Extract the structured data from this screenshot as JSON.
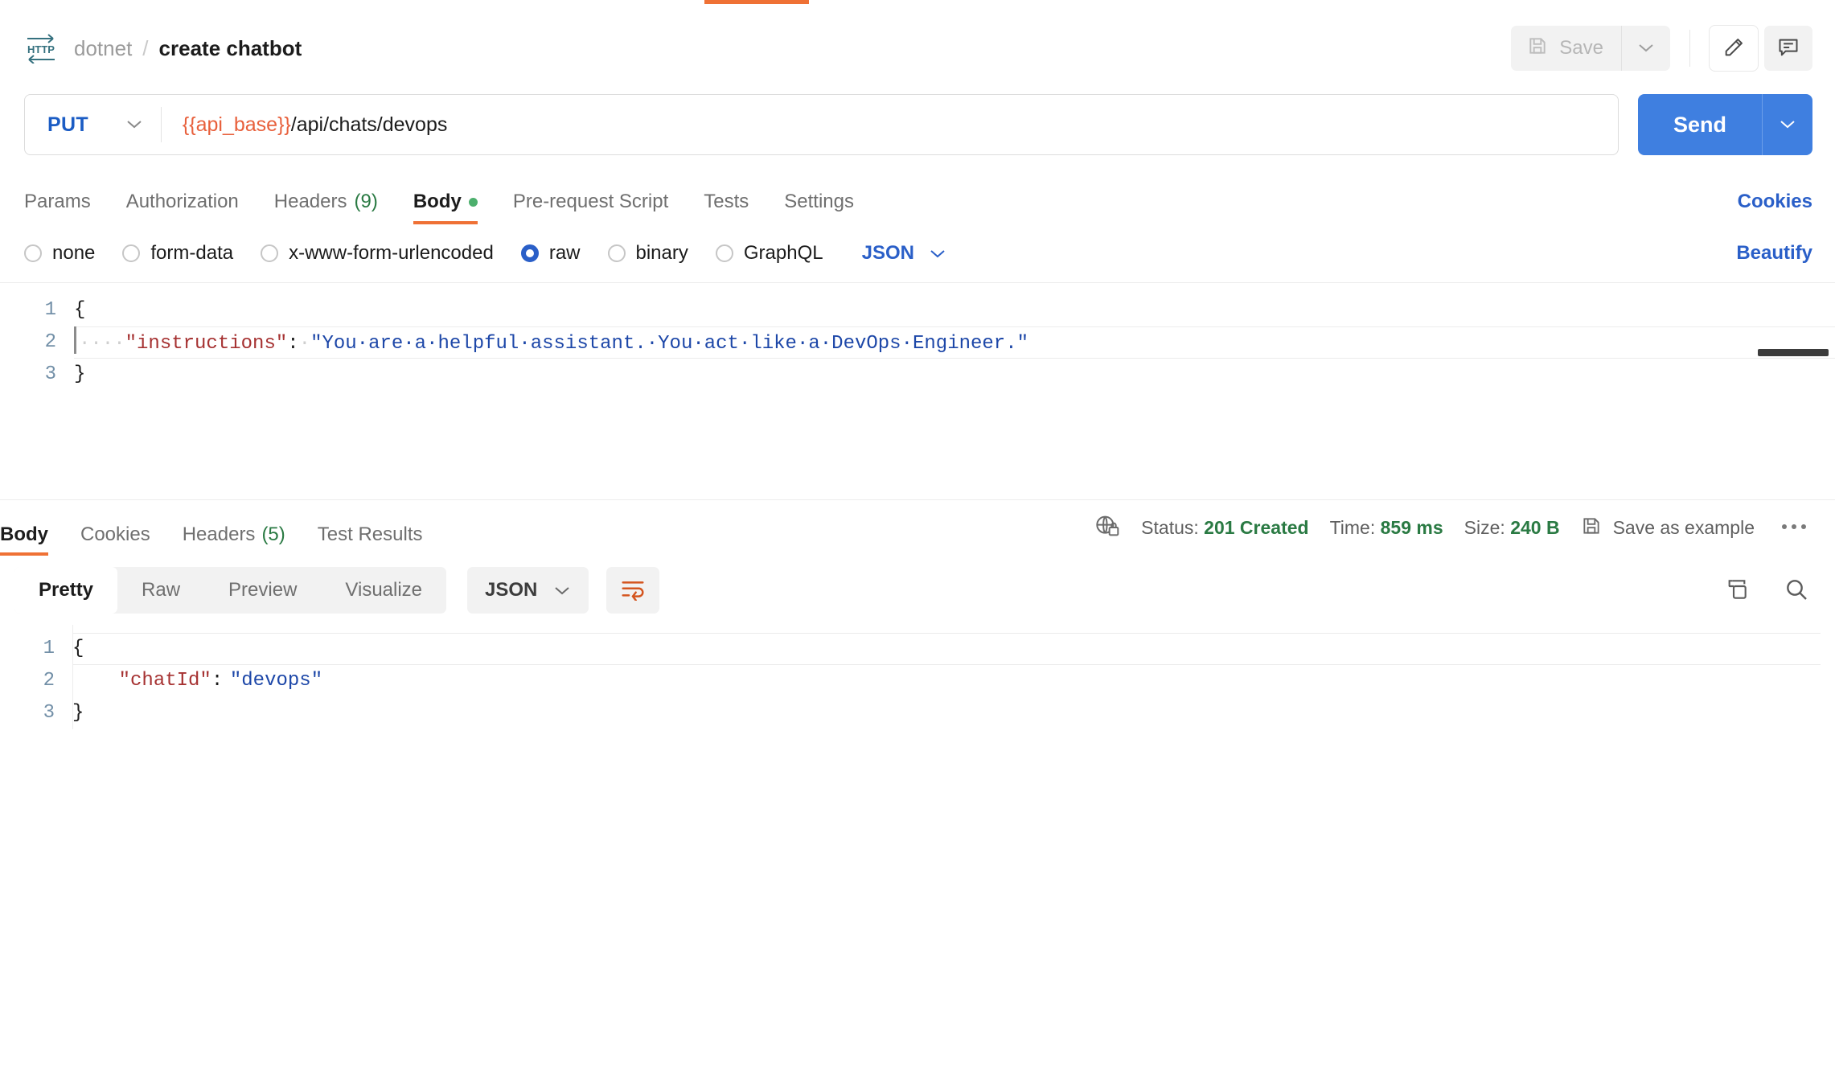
{
  "window": {
    "tab_indicator_color": "#ef7135"
  },
  "header": {
    "protocol_icon": "http-icon",
    "collection": "dotnet",
    "separator": "/",
    "request_name": "create chatbot",
    "save_label": "Save",
    "save_icon": "floppy-disk-icon",
    "save_caret_icon": "chevron-down-icon",
    "edit_icon": "pencil-icon",
    "comment_icon": "comment-icon"
  },
  "urlbar": {
    "method": "PUT",
    "method_color": "#1b5cc4",
    "method_caret_icon": "chevron-down-icon",
    "url_variable": "{{api_base}}",
    "url_path": "/api/chats/devops",
    "url_variable_color": "#e8603c",
    "send_label": "Send",
    "send_caret_icon": "chevron-down-icon",
    "send_color": "#3f7fe0"
  },
  "request_tabs": {
    "items": [
      {
        "label": "Params",
        "count": null,
        "active": false,
        "dot": false
      },
      {
        "label": "Authorization",
        "count": null,
        "active": false,
        "dot": false
      },
      {
        "label": "Headers",
        "count": "(9)",
        "active": false,
        "dot": false
      },
      {
        "label": "Body",
        "count": null,
        "active": true,
        "dot": true
      },
      {
        "label": "Pre-request Script",
        "count": null,
        "active": false,
        "dot": false
      },
      {
        "label": "Tests",
        "count": null,
        "active": false,
        "dot": false
      },
      {
        "label": "Settings",
        "count": null,
        "active": false,
        "dot": false
      }
    ],
    "cookies_link": "Cookies"
  },
  "body_type": {
    "options": [
      {
        "label": "none",
        "selected": false
      },
      {
        "label": "form-data",
        "selected": false
      },
      {
        "label": "x-www-form-urlencoded",
        "selected": false
      },
      {
        "label": "raw",
        "selected": true
      },
      {
        "label": "binary",
        "selected": false
      },
      {
        "label": "GraphQL",
        "selected": false
      }
    ],
    "format": "JSON",
    "format_caret_icon": "chevron-down-icon",
    "beautify_link": "Beautify"
  },
  "request_body": {
    "lines": [
      {
        "num": "1",
        "open_brace": "{"
      },
      {
        "num": "2",
        "indent_dots": "····",
        "key": "\"instructions\"",
        "colon": ":",
        "space_dot": "·",
        "value": "\"You·are·a·helpful·assistant.·You·act·like·a·DevOps·Engineer.\""
      },
      {
        "num": "3",
        "close_brace": "}"
      }
    ],
    "key_color": "#a63232",
    "value_color": "#1d47a8"
  },
  "response_tabs": {
    "items": [
      {
        "label": "Body",
        "count": null,
        "active": true
      },
      {
        "label": "Cookies",
        "count": null,
        "active": false
      },
      {
        "label": "Headers",
        "count": "(5)",
        "active": false
      },
      {
        "label": "Test Results",
        "count": null,
        "active": false
      }
    ]
  },
  "response_meta": {
    "security_icon": "globe-lock-icon",
    "status_label": "Status:",
    "status_value": "201 Created",
    "time_label": "Time:",
    "time_value": "859 ms",
    "size_label": "Size:",
    "size_value": "240 B",
    "save_example_icon": "floppy-disk-icon",
    "save_example_label": "Save as example",
    "more_icon": "ellipsis-icon",
    "value_color": "#2a7a43"
  },
  "response_toolbar": {
    "views": [
      {
        "label": "Pretty",
        "active": true
      },
      {
        "label": "Raw",
        "active": false
      },
      {
        "label": "Preview",
        "active": false
      },
      {
        "label": "Visualize",
        "active": false
      }
    ],
    "format": "JSON",
    "format_caret_icon": "chevron-down-icon",
    "wrap_icon": "word-wrap-icon",
    "wrap_icon_color": "#d4551f",
    "copy_icon": "copy-icon",
    "search_icon": "search-icon"
  },
  "response_body": {
    "lines": [
      {
        "num": "1",
        "open_brace": "{"
      },
      {
        "num": "2",
        "indent": "    ",
        "key": "\"chatId\"",
        "colon": ":",
        "value": "\"devops\""
      },
      {
        "num": "3",
        "close_brace": "}"
      }
    ],
    "key_color": "#a63232",
    "value_color": "#1d47a8"
  }
}
